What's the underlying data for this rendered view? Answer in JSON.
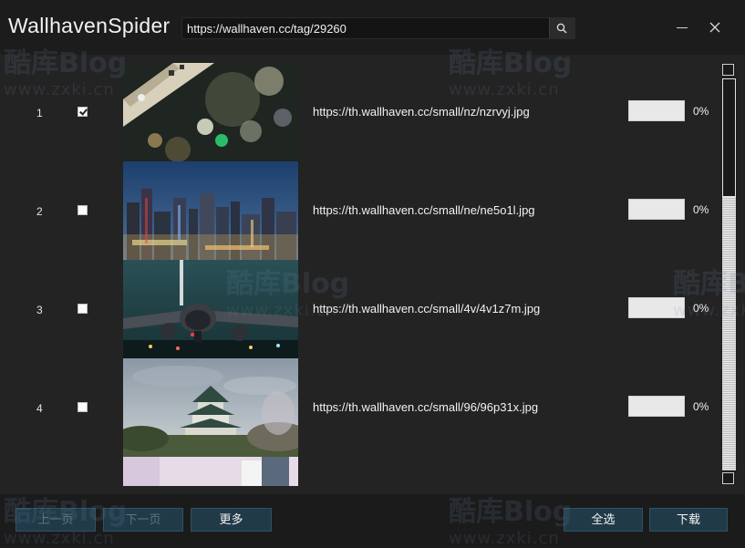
{
  "app": {
    "title": "WallhavenSpider"
  },
  "search": {
    "url": "https://wallhaven.cc/tag/29260"
  },
  "window": {
    "minimize_icon": "minimize-icon",
    "close_icon": "close-icon"
  },
  "watermark": {
    "brand": "酷库Blog",
    "domain": "www.zxki.cn"
  },
  "rows": [
    {
      "index": "1",
      "checked": true,
      "url": "https://th.wallhaven.cc/small/nz/nzrvyj.jpg",
      "progress": 0,
      "percent": "0%"
    },
    {
      "index": "2",
      "checked": false,
      "url": "https://th.wallhaven.cc/small/ne/ne5o1l.jpg",
      "progress": 0,
      "percent": "0%"
    },
    {
      "index": "3",
      "checked": false,
      "url": "https://th.wallhaven.cc/small/4v/4v1z7m.jpg",
      "progress": 0,
      "percent": "0%"
    },
    {
      "index": "4",
      "checked": false,
      "url": "https://th.wallhaven.cc/small/96/96p31x.jpg",
      "progress": 0,
      "percent": "0%"
    }
  ],
  "buttons": {
    "prev": "上一页",
    "next": "下一页",
    "more": "更多",
    "select_all": "全选",
    "download": "下载"
  },
  "colors": {
    "button_bg": "#203a48",
    "accent": "#3c8dde"
  }
}
